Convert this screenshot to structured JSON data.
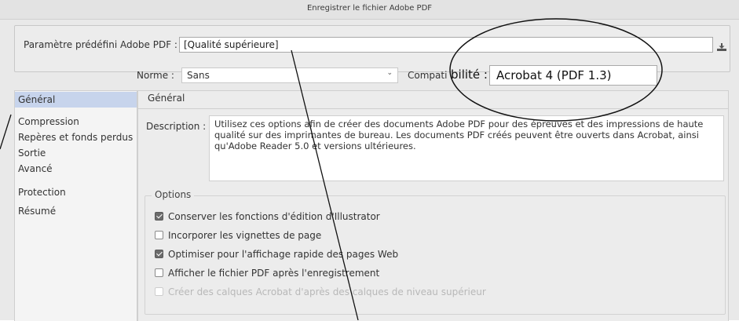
{
  "window": {
    "title": "Enregistrer le fichier Adobe PDF"
  },
  "preset": {
    "label": "Paramètre prédéfini Adobe PDF :",
    "value": "[Qualité supérieure]"
  },
  "norme": {
    "label": "Norme :",
    "value": "Sans"
  },
  "compat": {
    "label_partial": "Compati",
    "label_zoom": "bilité :",
    "value": "Acrobat 4 (PDF 1.3)"
  },
  "sidebar": {
    "items": [
      {
        "label": "Général",
        "selected": true
      },
      {
        "label": "Compression",
        "selected": false
      },
      {
        "label": "Repères et fonds perdus",
        "selected": false
      },
      {
        "label": "Sortie",
        "selected": false
      },
      {
        "label": "Avancé",
        "selected": false
      },
      {
        "label": "Protection",
        "selected": false
      },
      {
        "label": "Résumé",
        "selected": false
      }
    ]
  },
  "main": {
    "heading": "Général",
    "description_label": "Description :",
    "description_text": "Utilisez ces options afin de créer des documents Adobe PDF pour des épreuves et des impressions de haute qualité sur des imprimantes de bureau. Les documents PDF créés peuvent être ouverts dans Acrobat, ainsi qu'Adobe Reader 5.0 et versions ultérieures.",
    "options_title": "Options",
    "options": [
      {
        "label": "Conserver les fonctions d'édition d'Illustrator",
        "checked": true,
        "enabled": true
      },
      {
        "label": "Incorporer les vignettes de page",
        "checked": false,
        "enabled": true
      },
      {
        "label": "Optimiser pour l'affichage rapide des pages Web",
        "checked": true,
        "enabled": true
      },
      {
        "label": "Afficher le fichier PDF après l'enregistrement",
        "checked": false,
        "enabled": true
      },
      {
        "label": "Créer des calques Acrobat d'après des calques de niveau supérieur",
        "checked": false,
        "enabled": false
      }
    ]
  },
  "icons": {
    "save_preset": "save-preset-icon",
    "dropdown": "chevron-down-icon"
  }
}
